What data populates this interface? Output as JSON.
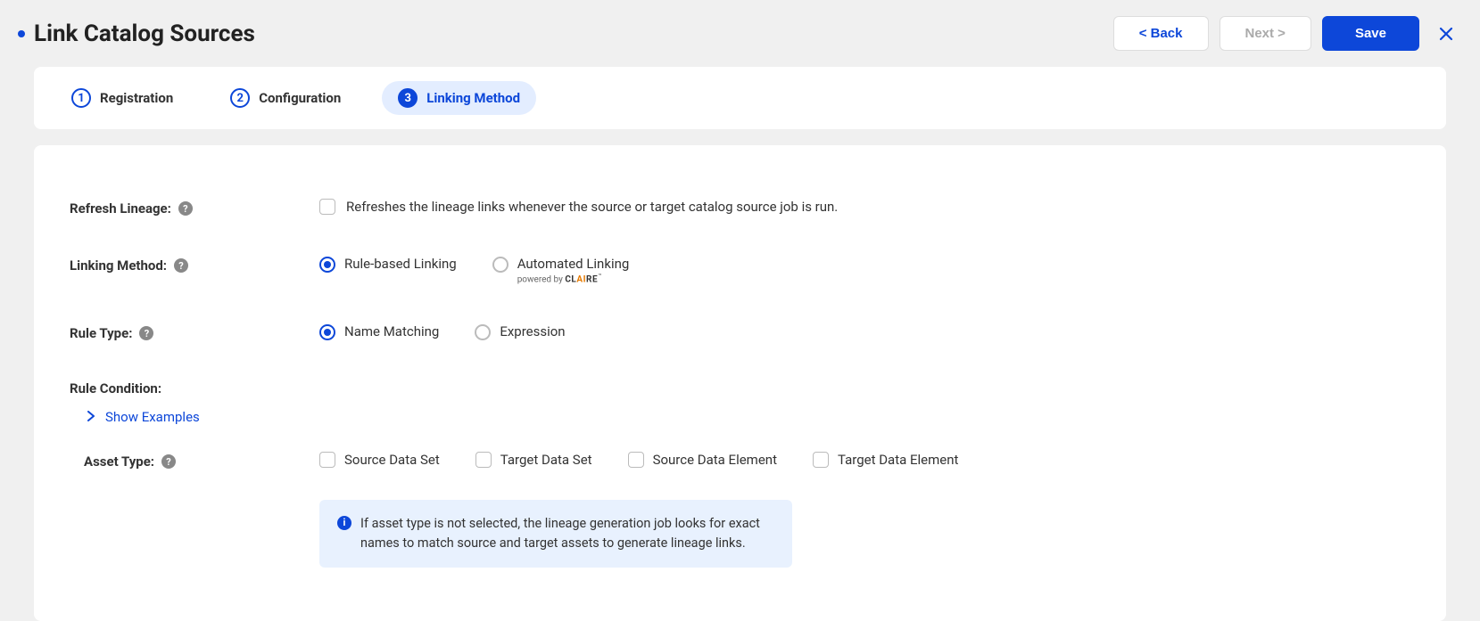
{
  "header": {
    "title": "Link Catalog Sources",
    "back": "< Back",
    "next": "Next >",
    "save": "Save"
  },
  "steps": [
    {
      "num": "1",
      "label": "Registration"
    },
    {
      "num": "2",
      "label": "Configuration"
    },
    {
      "num": "3",
      "label": "Linking Method"
    }
  ],
  "form": {
    "refresh_label": "Refresh Lineage:",
    "refresh_desc": "Refreshes the lineage links whenever the source or target catalog source job is run.",
    "linking_method_label": "Linking Method:",
    "linking_options": {
      "rule": "Rule-based Linking",
      "auto": "Automated Linking",
      "powered_by": "powered by "
    },
    "rule_type_label": "Rule Type:",
    "rule_type_options": {
      "name": "Name Matching",
      "expr": "Expression"
    },
    "rule_condition_label": "Rule Condition:",
    "show_examples": "Show Examples",
    "asset_type_label": "Asset Type:",
    "asset_types": {
      "sds": "Source Data Set",
      "tds": "Target Data Set",
      "sde": "Source Data Element",
      "tde": "Target Data Element"
    },
    "info": "If asset type is not selected, the lineage generation job looks for exact names to match source and target assets to generate lineage links."
  }
}
